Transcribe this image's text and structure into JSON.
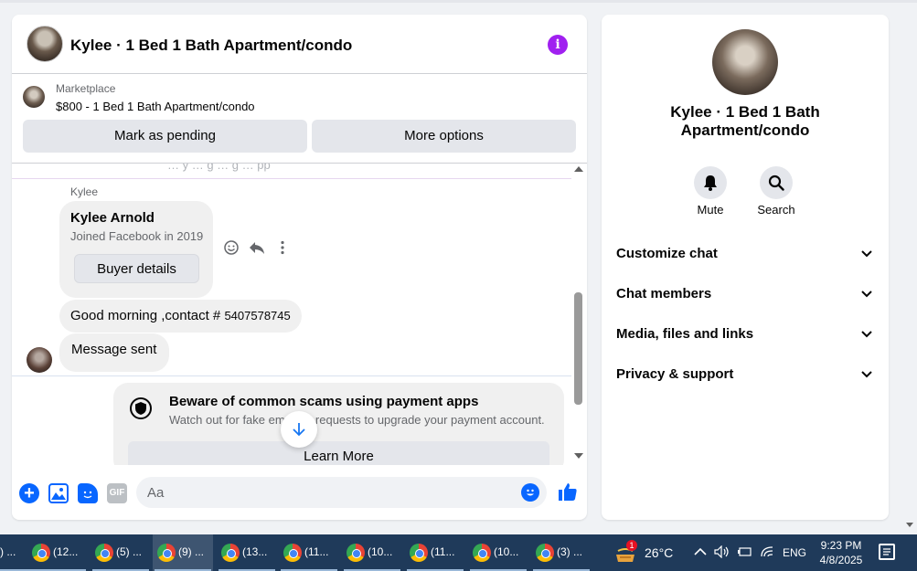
{
  "chat": {
    "title": "Kylee · 1 Bed 1 Bath Apartment/condo",
    "marketplace_label": "Marketplace",
    "listing": "$800 - 1 Bed 1 Bath Apartment/condo",
    "mark_pending_label": "Mark as pending",
    "more_options_label": "More options"
  },
  "thread": {
    "sender": "Kylee",
    "buyer_name": "Kylee Arnold",
    "buyer_joined": "Joined Facebook in 2019",
    "buyer_details_label": "Buyer details",
    "message1_text": "Good morning ,contact # ",
    "message1_phone": "5407578745",
    "message2": "Message sent",
    "scam_title": "Beware of common scams using payment apps",
    "scam_desc": "Watch out for fake em       r requests to upgrade your payment account.",
    "learn_more_label": "Learn More"
  },
  "composer": {
    "placeholder": "Aa",
    "gif_label": "GIF"
  },
  "info": {
    "title": "Kylee · 1 Bed 1 Bath Apartment/condo",
    "mute_label": "Mute",
    "search_label": "Search",
    "sections": [
      {
        "label": "Customize chat"
      },
      {
        "label": "Chat members"
      },
      {
        "label": "Media, files and links"
      },
      {
        "label": "Privacy & support"
      }
    ]
  },
  "taskbar": {
    "items": [
      {
        "label": ") ..."
      },
      {
        "label": "(12..."
      },
      {
        "label": "(5) ..."
      },
      {
        "label": "(9) ..."
      },
      {
        "label": "(13..."
      },
      {
        "label": "(11..."
      },
      {
        "label": "(10..."
      },
      {
        "label": "(11..."
      },
      {
        "label": "(10..."
      },
      {
        "label": "(3) ..."
      }
    ],
    "weather_badge": "1",
    "temperature": "26°C",
    "language": "ENG",
    "time": "9:23 PM",
    "date": "4/8/2025"
  },
  "colors": {
    "accent": "#0866ff",
    "info_icon": "#a020f0",
    "taskbar": "#1f3a5a"
  }
}
